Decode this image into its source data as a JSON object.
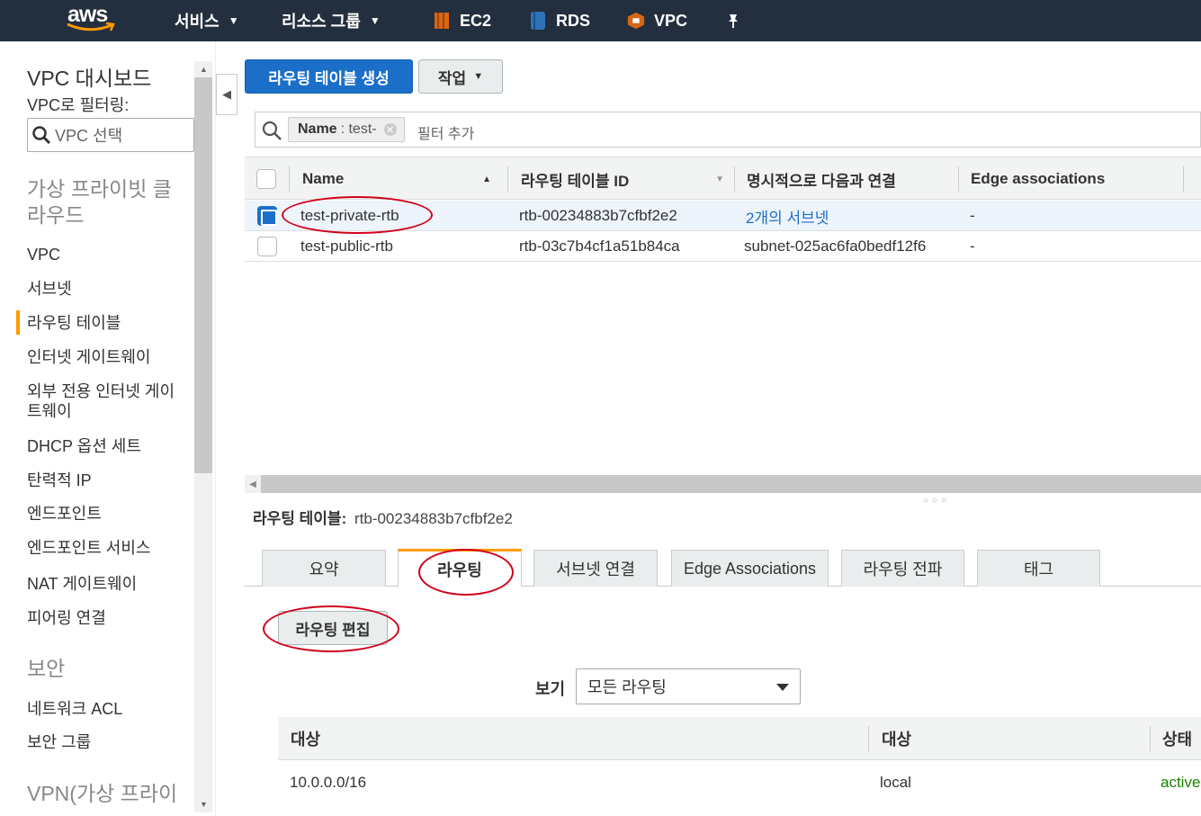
{
  "topnav": {
    "logo": "aws",
    "items": [
      {
        "label": "서비스",
        "icon": "chevron-down-icon"
      },
      {
        "label": "리소스 그룹",
        "icon": "chevron-down-icon"
      },
      {
        "label": "EC2",
        "icon": "ec2-icon",
        "color": "#d86613"
      },
      {
        "label": "RDS",
        "icon": "rds-icon",
        "color": "#2e73b8"
      },
      {
        "label": "VPC",
        "icon": "vpc-icon",
        "color": "#d86613"
      }
    ],
    "pin_icon": "pin-icon"
  },
  "sidebar": {
    "title": "VPC 대시보드",
    "filter_label": "VPC로 필터링:",
    "filter_placeholder": "VPC 선택",
    "section_vpc": "가상 프라이빗 클라우드",
    "items": [
      "VPC",
      "서브넷",
      "라우팅 테이블",
      "인터넷 게이트웨이",
      "외부 전용 인터넷 게이트웨이",
      "DHCP 옵션 세트",
      "탄력적 IP",
      "엔드포인트",
      "엔드포인트 서비스",
      "NAT 게이트웨이",
      "피어링 연결"
    ],
    "active_item": "라우팅 테이블",
    "section_security": "보안",
    "security_items": [
      "네트워크 ACL",
      "보안 그룹"
    ],
    "section_vpn": "VPN(가상 프라이"
  },
  "toolbar": {
    "create_label": "라우팅 테이블 생성",
    "action_label": "작업"
  },
  "filter": {
    "chip_key": "Name",
    "chip_value": ": test-",
    "add_placeholder": "필터 추가"
  },
  "table": {
    "columns": [
      "Name",
      "라우팅 테이블 ID",
      "명시적으로 다음과 연결",
      "Edge associations"
    ],
    "rows": [
      {
        "name": "test-private-rtb",
        "id": "rtb-00234883b7cfbf2e2",
        "assoc": "2개의 서브넷",
        "edge": "-",
        "selected": true
      },
      {
        "name": "test-public-rtb",
        "id": "rtb-03c7b4cf1a51b84ca",
        "assoc": "subnet-025ac6fa0bedf12f6",
        "edge": "-",
        "selected": false
      }
    ]
  },
  "detail": {
    "title_label": "라우팅 테이블:",
    "title_id": "rtb-00234883b7cfbf2e2",
    "tabs": [
      "요약",
      "라우팅",
      "서브넷 연결",
      "Edge Associations",
      "라우팅 전파",
      "태그"
    ],
    "active_tab": "라우팅",
    "edit_button": "라우팅 편집",
    "view_label": "보기",
    "view_value": "모든 라우팅",
    "routes_columns": [
      "대상",
      "대상",
      "상태"
    ],
    "routes": [
      {
        "destination": "10.0.0.0/16",
        "target": "local",
        "status": "active"
      }
    ]
  },
  "colors": {
    "nav_bg": "#232f3e",
    "primary": "#1b6fc9",
    "accent": "#ff9900",
    "annotation": "#d0021b",
    "status_active": "#1d8102"
  }
}
